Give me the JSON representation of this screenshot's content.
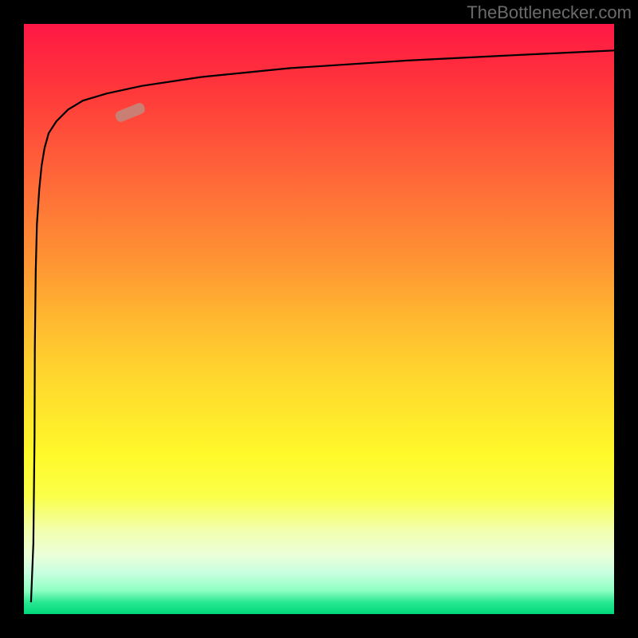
{
  "watermark": "TheBottlenecker.com",
  "chart_data": {
    "type": "line",
    "title": "",
    "xlabel": "",
    "ylabel": "",
    "xlim": [
      0,
      100
    ],
    "ylim": [
      0,
      100
    ],
    "grid": false,
    "annotations": [
      {
        "type": "marker",
        "x": 18,
        "y": 85,
        "shape": "pill",
        "color": "#c97f73"
      }
    ],
    "background_gradient": {
      "direction": "vertical",
      "stops": [
        {
          "pos": 0,
          "color": "#ff1744"
        },
        {
          "pos": 50,
          "color": "#ffb830"
        },
        {
          "pos": 73,
          "color": "#fff92a"
        },
        {
          "pos": 96,
          "color": "#8effc2"
        },
        {
          "pos": 100,
          "color": "#00d87a"
        }
      ]
    },
    "series": [
      {
        "name": "curve",
        "x": [
          1.2,
          1.6,
          1.8,
          1.85,
          2.0,
          2.2,
          2.6,
          3.0,
          3.5,
          4.2,
          5.5,
          7.5,
          10,
          14,
          20,
          30,
          45,
          65,
          85,
          100
        ],
        "y": [
          2,
          12,
          30,
          45,
          58,
          66,
          72,
          76,
          79,
          81.5,
          83.5,
          85.5,
          87,
          88.2,
          89.5,
          91,
          92.5,
          93.8,
          94.8,
          95.5
        ]
      }
    ]
  }
}
